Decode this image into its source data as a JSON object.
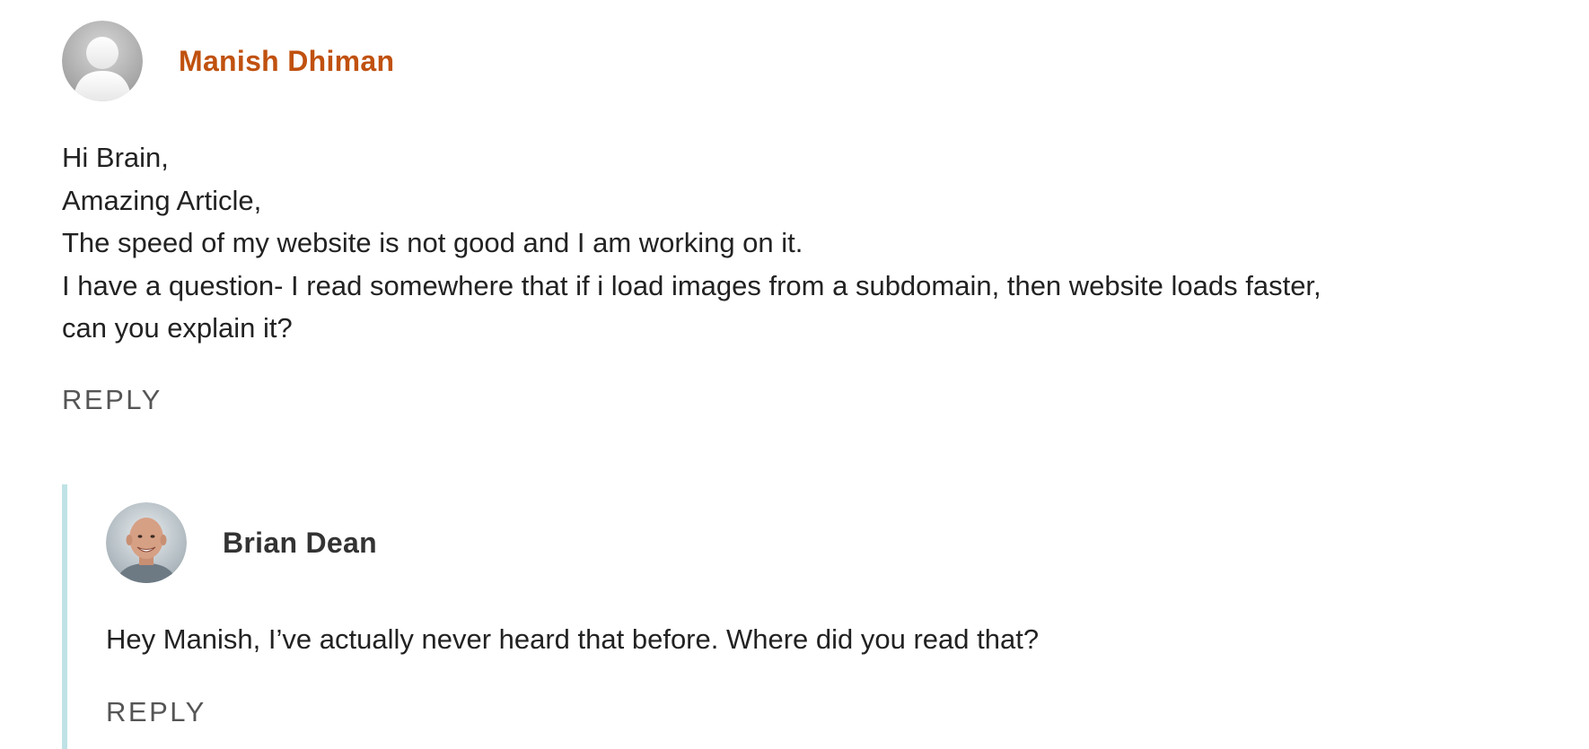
{
  "comments": [
    {
      "author": "Manish Dhiman",
      "author_color": "#c0510f",
      "avatar_icon": "default-user-avatar",
      "body_lines": [
        "Hi Brain,",
        "Amazing Article,",
        "The speed of my website is not good and I am working on it.",
        "I have a question- I read somewhere that if i load images from a subdomain, then website loads faster,",
        "can you explain it?"
      ],
      "reply_label": "REPLY"
    }
  ],
  "replies": [
    {
      "author": "Brian Dean",
      "avatar_icon": "user-photo-avatar",
      "body_lines": [
        "Hey Manish, I’ve actually never heard that before. Where did you read that?"
      ],
      "reply_label": "REPLY"
    }
  ],
  "colors": {
    "author_link": "#c0510f",
    "thread_border": "#bfe2e6",
    "text": "#222222",
    "reply": "#555555"
  }
}
